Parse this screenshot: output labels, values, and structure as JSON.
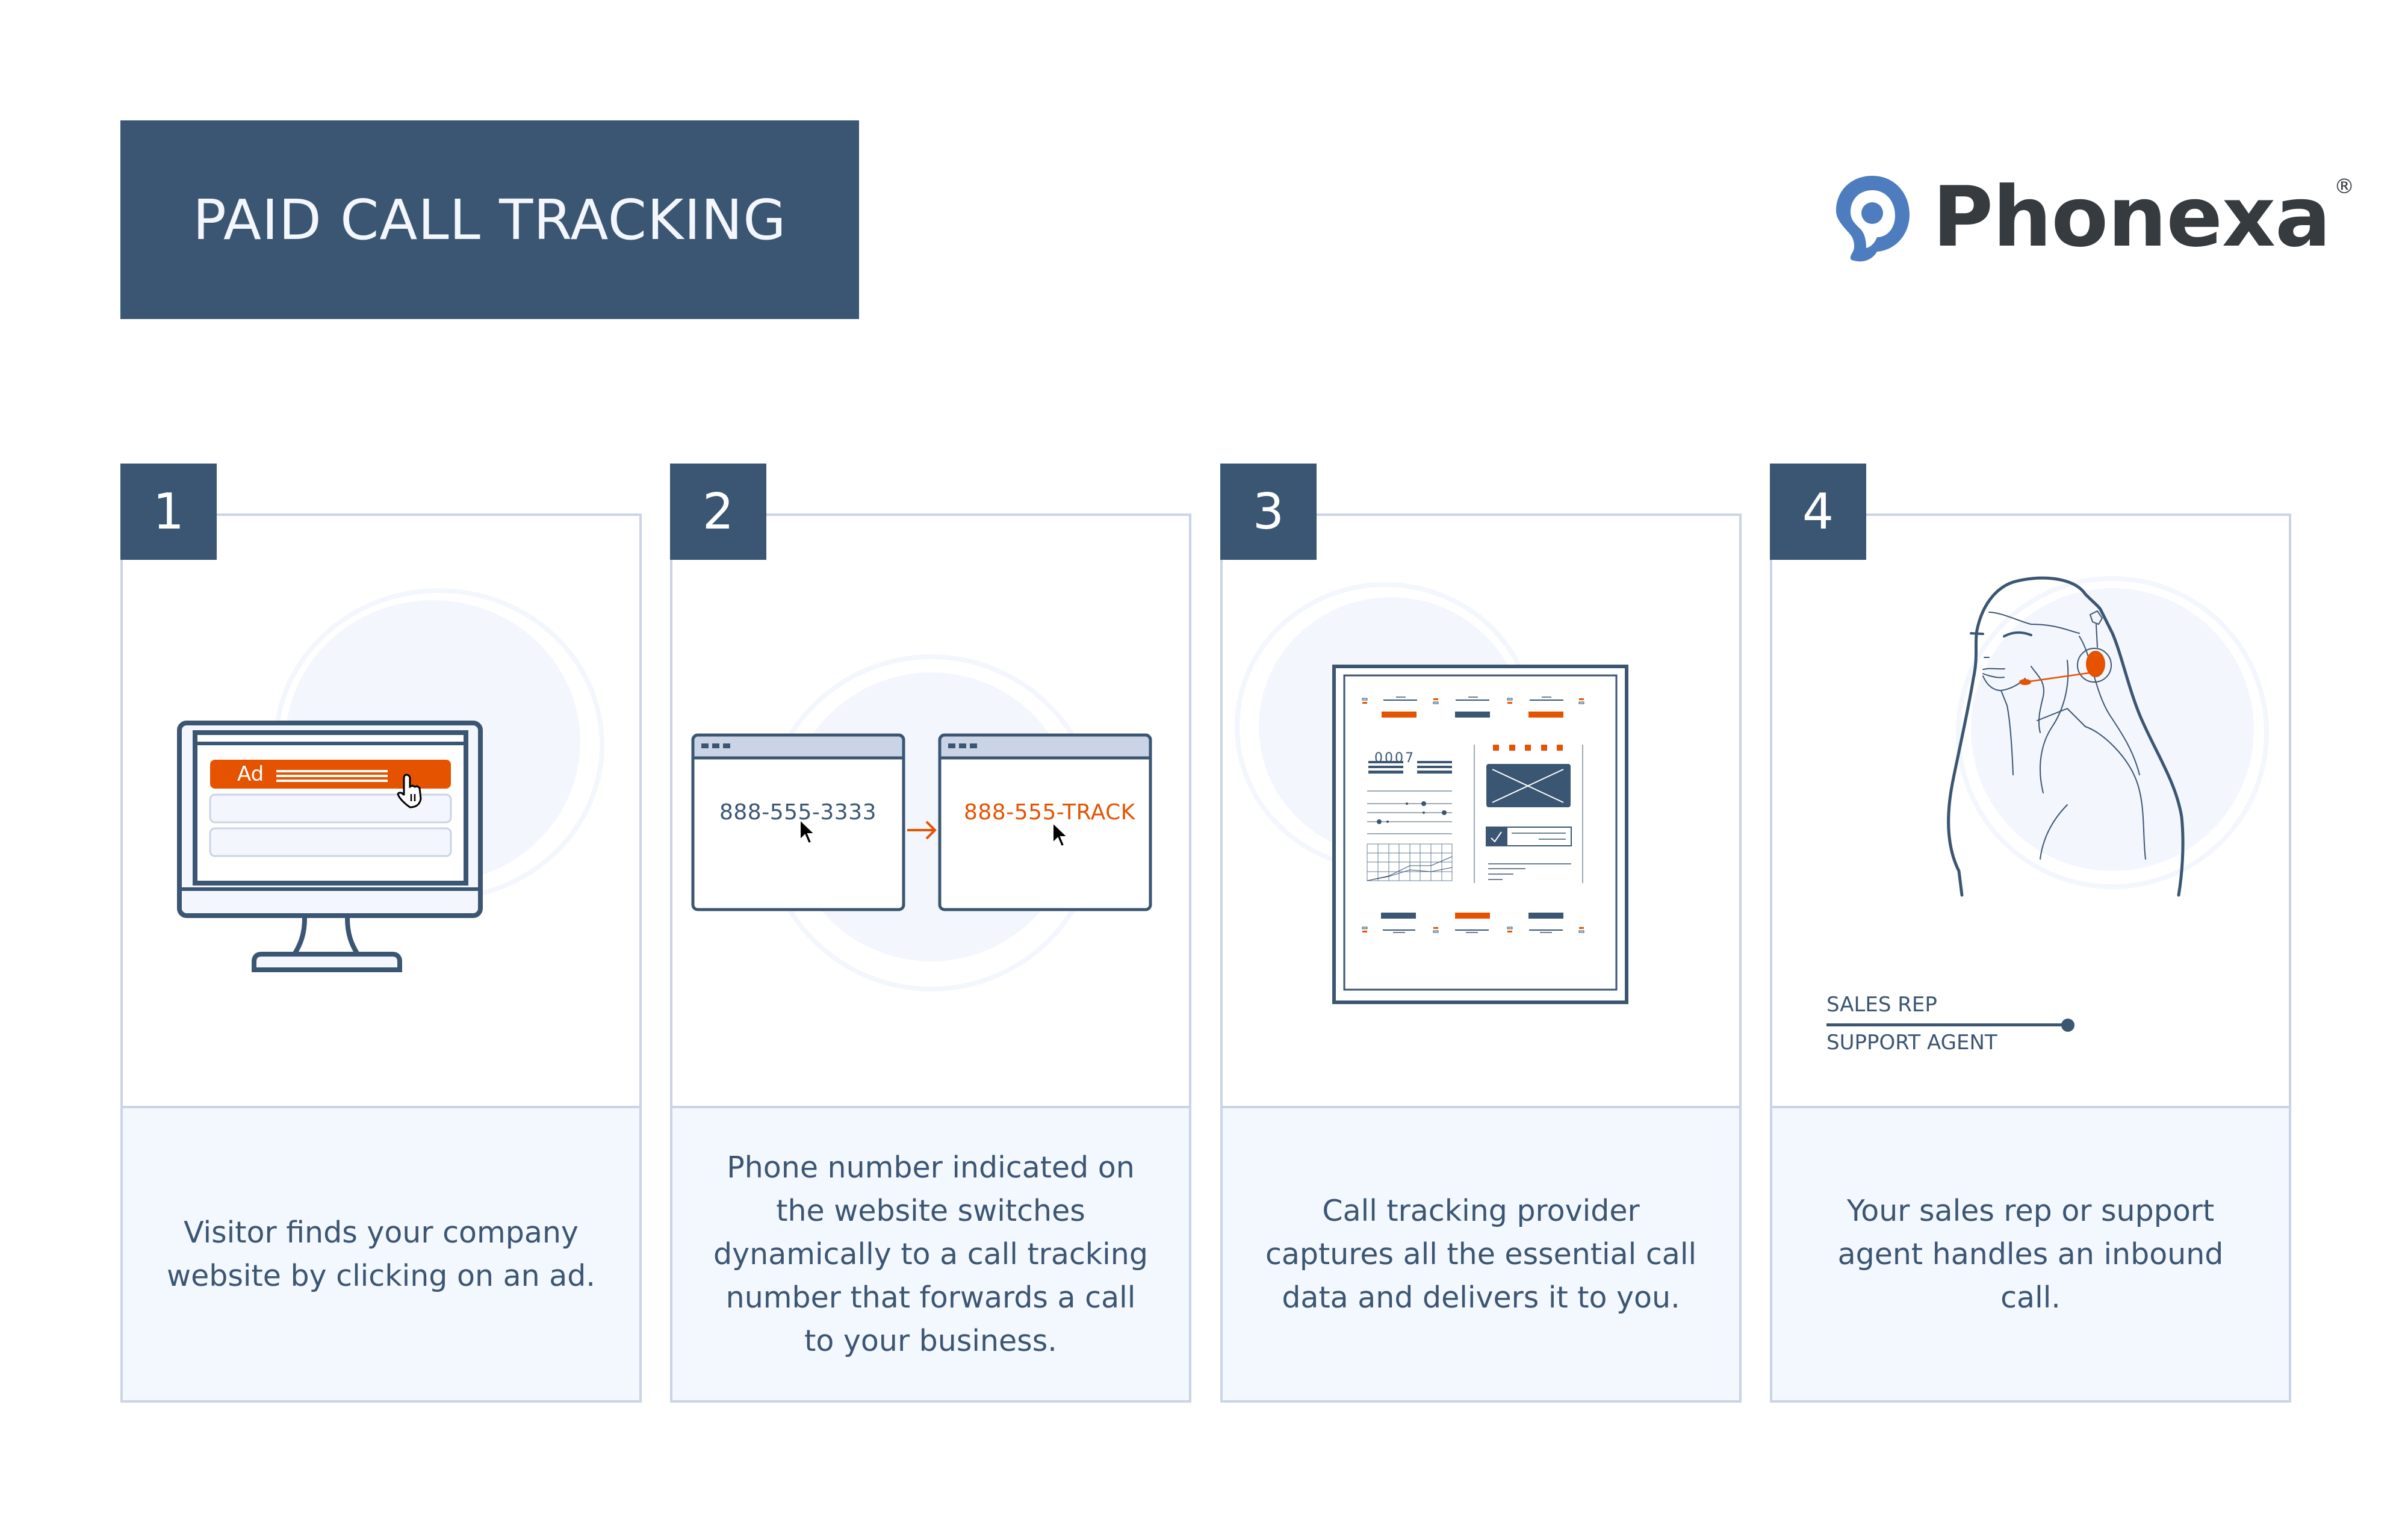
{
  "header": {
    "title": "PAID CALL TRACKING",
    "brand": {
      "name": "Phonexa",
      "registered_mark": "®",
      "icon": "phonexa-speech-bubble-icon"
    }
  },
  "colors": {
    "primary": "#3b5673",
    "accent": "#e55300",
    "logo_blue": "#4d7dbf",
    "card_border": "#cad4e6",
    "card_fill": "#f3f7fe",
    "logo_text": "#363b3f"
  },
  "steps": [
    {
      "number": "1",
      "illustration": "monitor-with-ad-icon",
      "ad_label": "Ad",
      "description": "Visitor finds your company website by clicking on an ad."
    },
    {
      "number": "2",
      "illustration": "browser-windows-number-swap-icon",
      "original_number": "888-555-3333",
      "tracking_number": "888-555-TRACK",
      "description": "Phone number indicated on the website switches dynamically to a call tracking number that forwards a call to your business."
    },
    {
      "number": "3",
      "illustration": "call-data-report-icon",
      "report_code": "0007",
      "description": "Call tracking provider captures all the essential call data and delivers it to you."
    },
    {
      "number": "4",
      "illustration": "agent-with-headset-icon",
      "roles": [
        "SALES REP",
        "SUPPORT AGENT"
      ],
      "description": "Your sales rep or support agent handles an inbound call."
    }
  ]
}
